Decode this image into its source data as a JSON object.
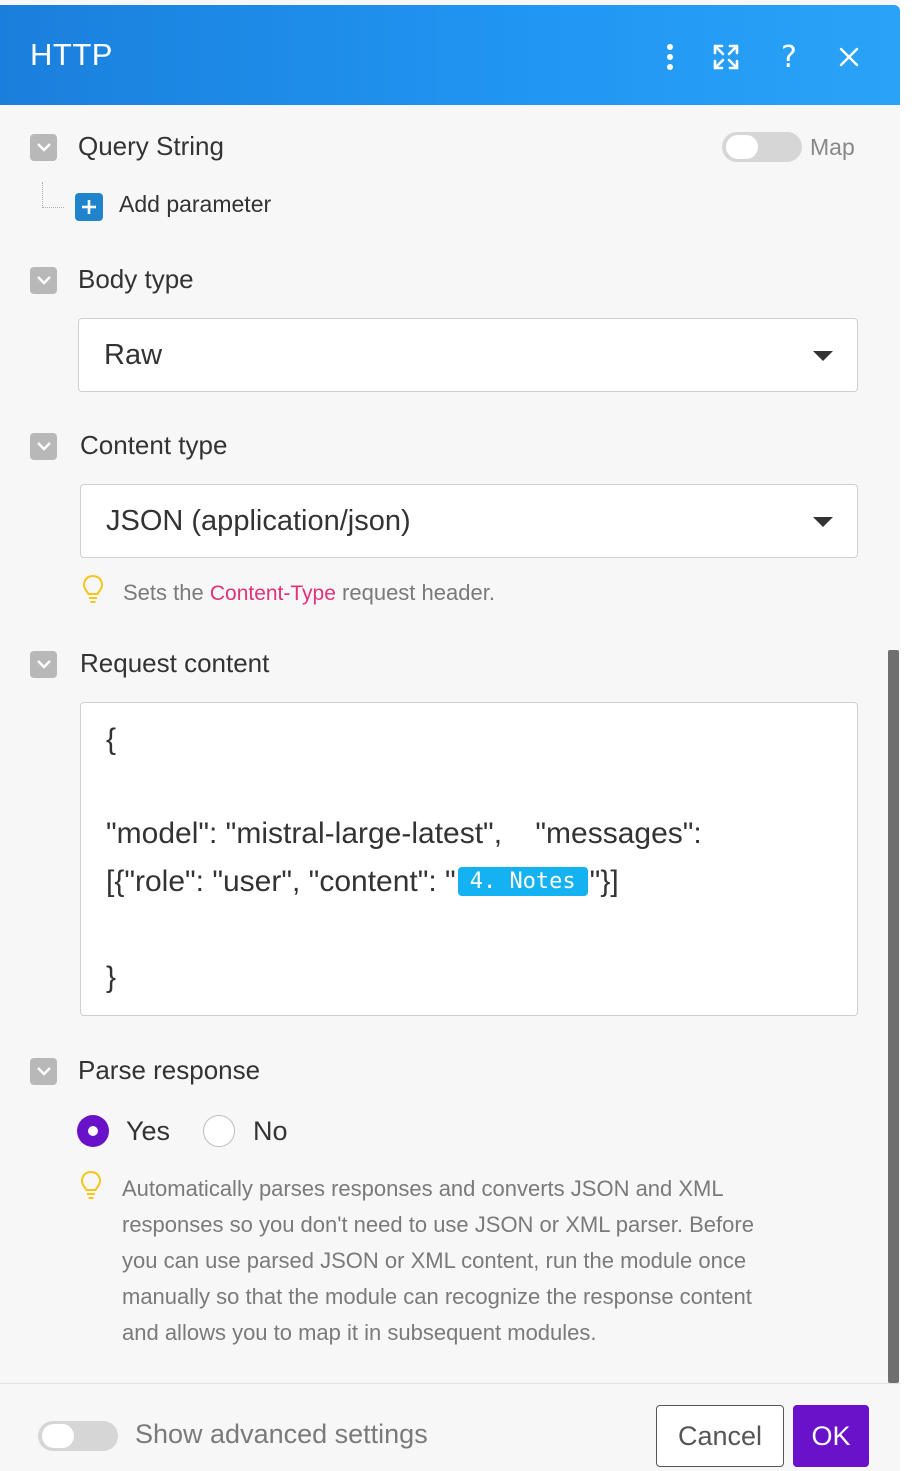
{
  "header": {
    "title": "HTTP",
    "icons": [
      "more-vertical-icon",
      "expand-icon",
      "help-icon",
      "close-icon"
    ],
    "help_glyph": "?"
  },
  "query_string": {
    "label": "Query String",
    "map_label": "Map",
    "map_enabled": false,
    "add_label": "Add parameter"
  },
  "body_type": {
    "label": "Body type",
    "value": "Raw"
  },
  "content_type": {
    "label": "Content type",
    "value": "JSON (application/json)",
    "hint_before": "Sets the ",
    "hint_code": "Content-Type",
    "hint_after": " request header."
  },
  "request_content": {
    "label": "Request content",
    "line_open": "{",
    "line_model": "\"model\": \"mistral-large-latest\",    \"messages\":",
    "line_messages_before": "[{\"role\": \"user\", \"content\": \"",
    "pill": "4. Notes",
    "line_messages_after": "\"}]",
    "line_close": "}"
  },
  "parse_response": {
    "label": "Parse response",
    "option_yes": "Yes",
    "option_no": "No",
    "selected": "Yes",
    "hint_lines": [
      "Automatically parses responses and converts JSON and XML",
      "responses so you don't need to use JSON or XML parser. Before",
      "you can use parsed JSON or XML content, run the module once",
      "manually so that the module can recognize the response content",
      "and allows you to map it in subsequent modules."
    ]
  },
  "footer": {
    "advanced_label": "Show advanced settings",
    "advanced_enabled": false,
    "cancel_label": "Cancel",
    "ok_label": "OK"
  },
  "colors": {
    "header_blue": "#1f8ce6",
    "accent_purple": "#6a12c9",
    "pill_blue": "#14b2f0",
    "hint_code_pink": "#e0327a",
    "bulb_yellow": "#f5c518"
  }
}
